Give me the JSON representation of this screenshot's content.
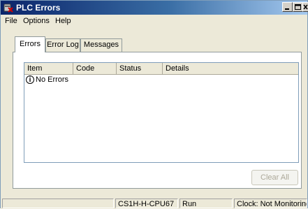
{
  "window": {
    "title": "PLC Errors",
    "icon": "plc-error-icon"
  },
  "menu": [
    "File",
    "Options",
    "Help"
  ],
  "tabs": [
    {
      "label": "Errors",
      "active": true
    },
    {
      "label": "Error Log",
      "active": false
    },
    {
      "label": "Messages",
      "active": false
    }
  ],
  "list": {
    "columns": [
      "Item",
      "Code",
      "Status",
      "Details"
    ],
    "rows": [
      {
        "icon": "info-icon",
        "item": "No Errors"
      }
    ]
  },
  "buttons": {
    "clear_all": "Clear All"
  },
  "status": {
    "cpu": "CS1H-H-CPU67",
    "mode": "Run",
    "clock": "Clock: Not Monitoring"
  },
  "colors": {
    "titlebar": "#0a246a",
    "window": "#ece9d8"
  }
}
